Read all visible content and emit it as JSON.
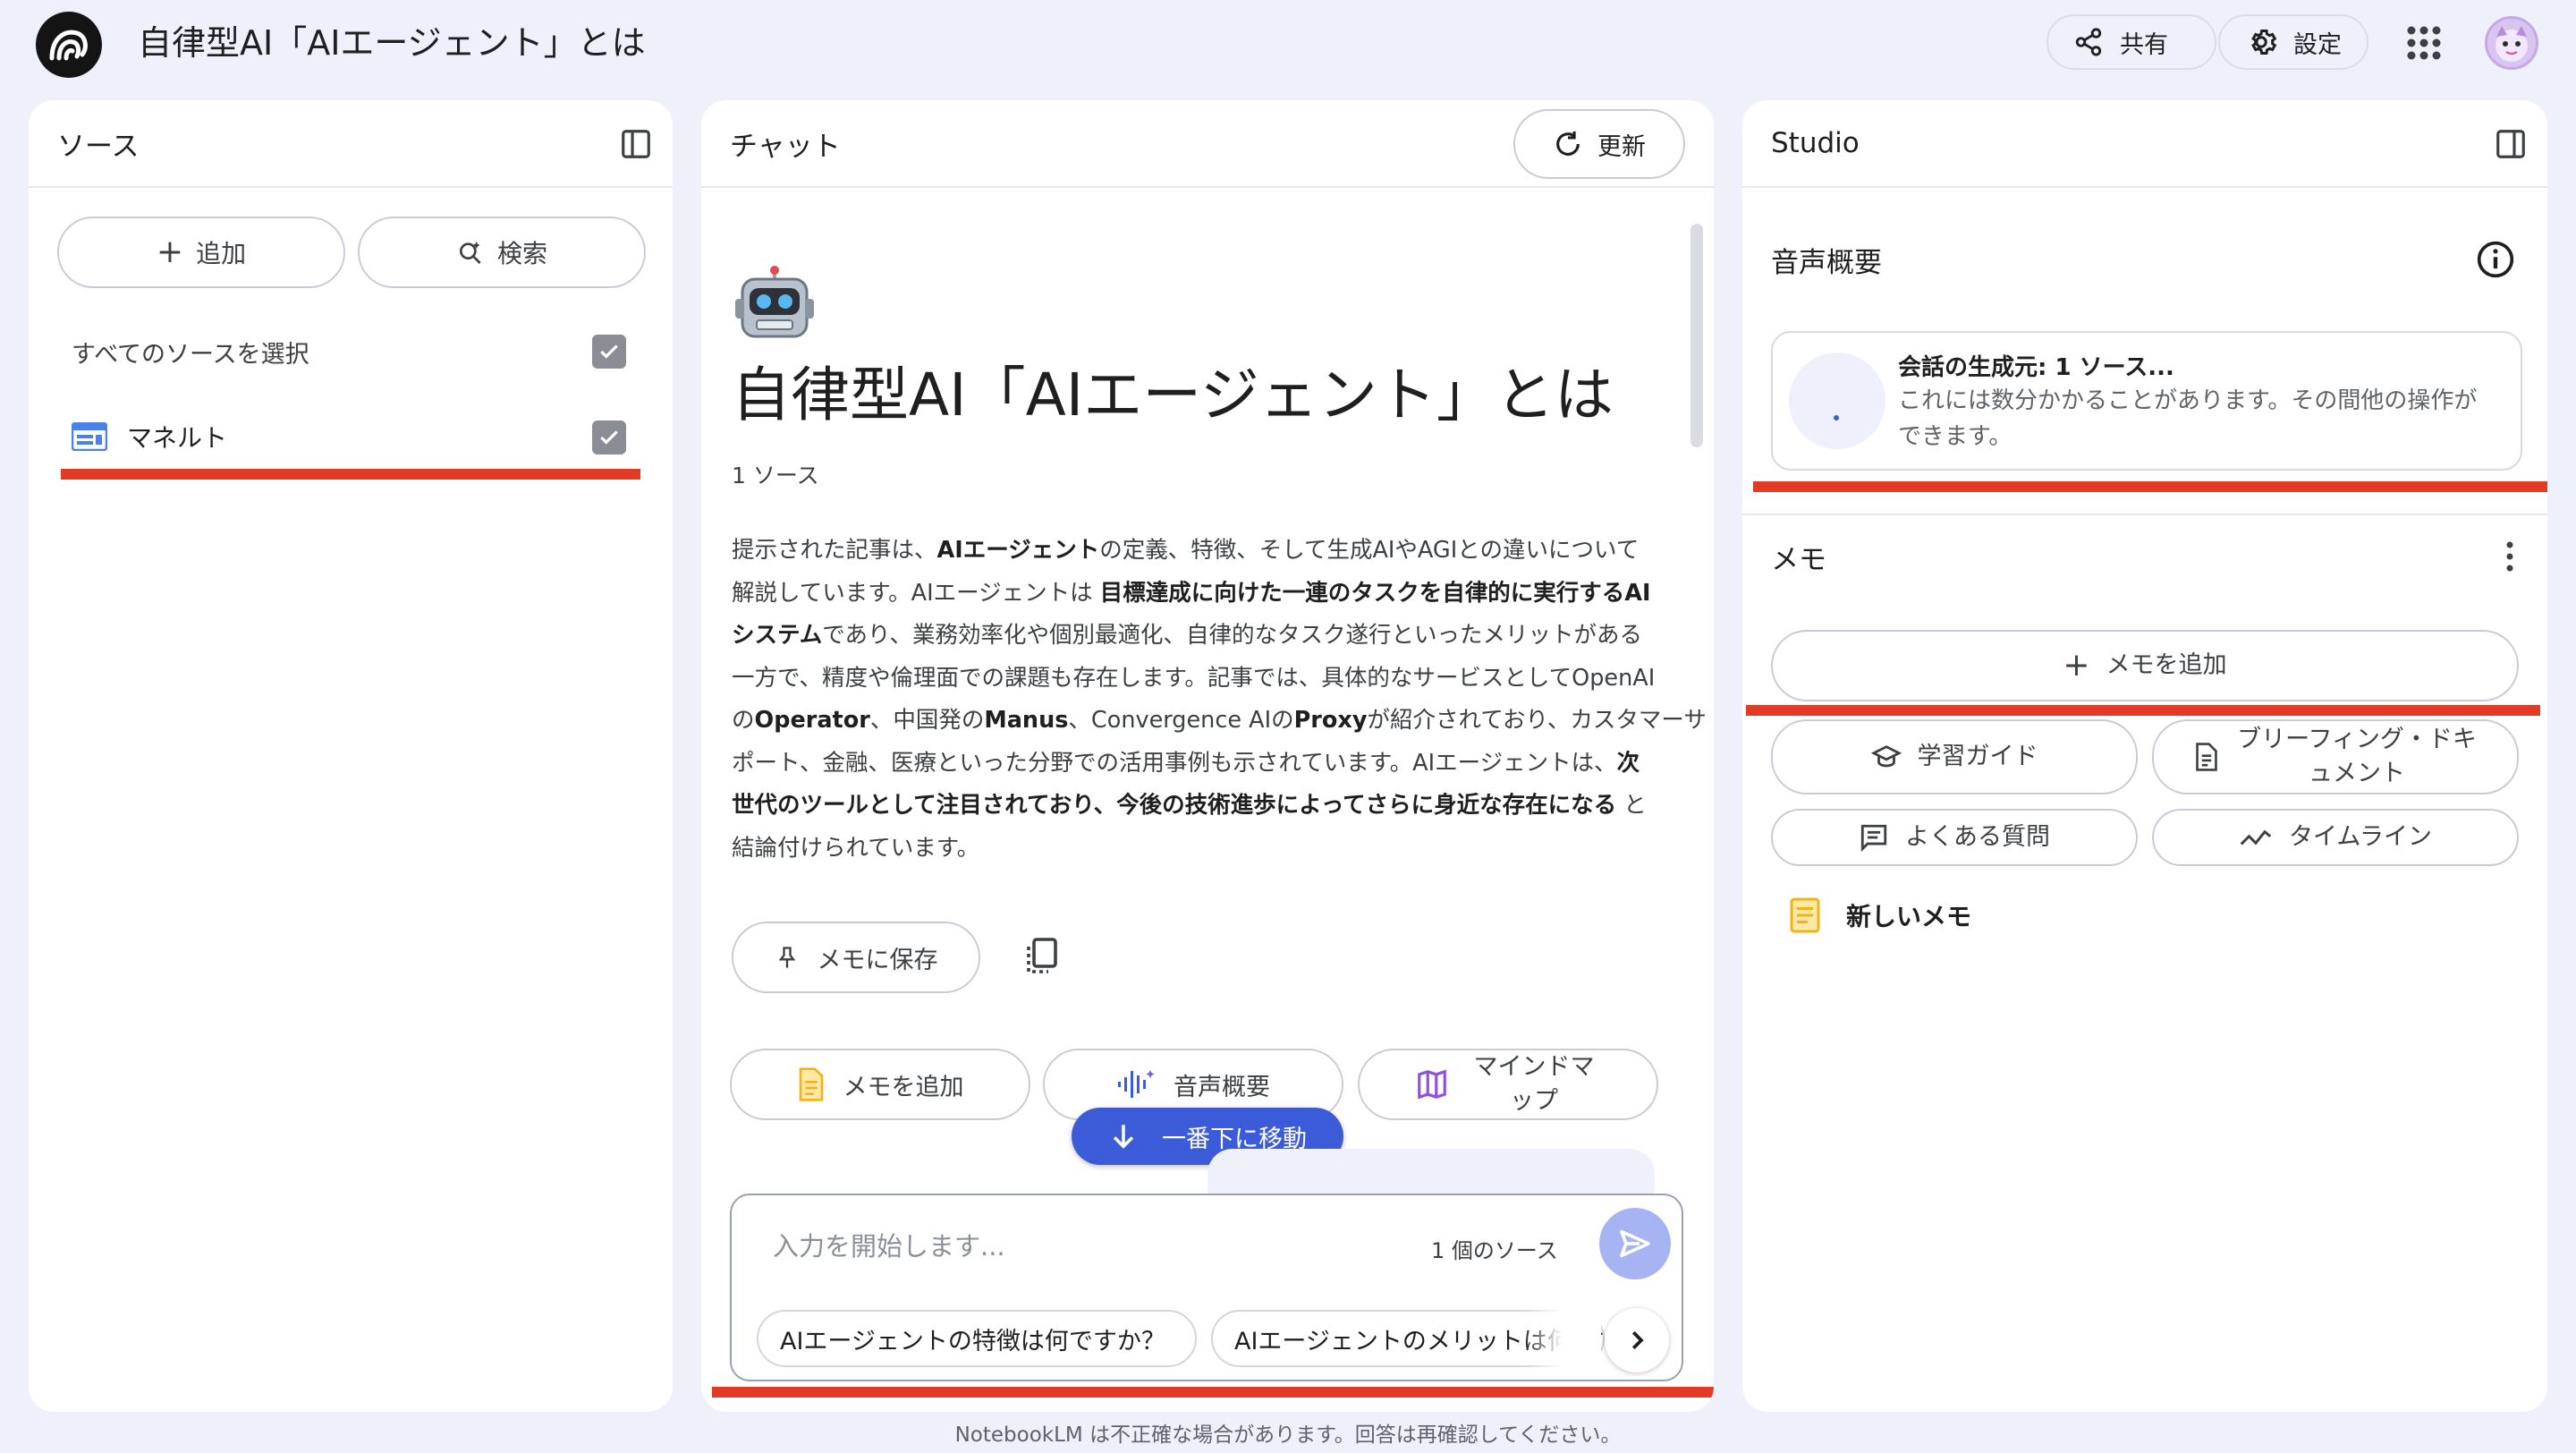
{
  "header": {
    "title": "自律型AI「AIエージェント」とは",
    "share_label": "共有",
    "settings_label": "設定"
  },
  "sources": {
    "title": "ソース",
    "add_label": "追加",
    "search_label": "検索",
    "select_all_label": "すべてのソースを選択",
    "items": [
      {
        "label": "マネルト",
        "checked": true
      }
    ]
  },
  "chat": {
    "title": "チャット",
    "refresh_label": "更新",
    "doc_title": "自律型AI「AIエージェント」とは",
    "source_count": "1 ソース",
    "summary_lines": [
      [
        {
          "t": "提示された記事は、"
        },
        {
          "t": "AIエージェント",
          "b": true
        },
        {
          "t": "の定義、特徴、そして生成AIやAGIとの違いについて"
        }
      ],
      [
        {
          "t": "解説しています。AIエージェントは "
        },
        {
          "t": "目標達成に向けた一連のタスクを自律的に実行するAI",
          "b": true
        }
      ],
      [
        {
          "t": "システム",
          "b": true
        },
        {
          "t": "であり、業務効率化や個別最適化、自律的なタスク遂行といったメリットがある"
        }
      ],
      [
        {
          "t": "一方で、精度や倫理面での課題も存在します。記事では、具体的なサービスとしてOpenAI"
        }
      ],
      [
        {
          "t": "の"
        },
        {
          "t": "Operator",
          "b": true
        },
        {
          "t": "、中国発の"
        },
        {
          "t": "Manus",
          "b": true
        },
        {
          "t": "、Convergence AIの"
        },
        {
          "t": "Proxy",
          "b": true
        },
        {
          "t": "が紹介されており、カスタマーサ"
        }
      ],
      [
        {
          "t": "ポート、金融、医療といった分野での活用事例も示されています。AIエージェントは、"
        },
        {
          "t": "次",
          "b": true
        }
      ],
      [
        {
          "t": "世代のツールとして注目されており、今後の技術進歩によってさらに身近な存在になる",
          "b": true
        },
        {
          "t": " と"
        }
      ],
      [
        {
          "t": "結論付けられています。"
        }
      ]
    ],
    "save_memo_label": "メモに保存",
    "add_memo_label": "メモを追加",
    "audio_label": "音声概要",
    "mindmap_label": "マインドマップ",
    "scroll_down_label": "一番下に移動",
    "input_placeholder": "入力を開始します...",
    "input_source_count": "1 個のソース",
    "suggestions": [
      "AIエージェントの特徴は何ですか？",
      "AIエージェントのメリットは何ですか"
    ]
  },
  "studio": {
    "title": "Studio",
    "audio_title": "音声概要",
    "generating_title": "会話の生成元: 1 ソース...",
    "generating_desc": "これには数分かかることがあります。その間他の操作ができます。",
    "memo_title": "メモ",
    "add_memo_label": "メモを追加",
    "study_guide_label": "学習ガイド",
    "briefing_label": "ブリーフィング・ドキュメント",
    "faq_label": "よくある質問",
    "timeline_label": "タイムライン",
    "new_memo_label": "新しいメモ"
  },
  "footer": {
    "note": "NotebookLM は不正確な場合があります。回答は再確認してください。"
  },
  "colors": {
    "highlight": "#e33a25",
    "accent": "#3b5bd9",
    "background": "#eef0fa"
  }
}
